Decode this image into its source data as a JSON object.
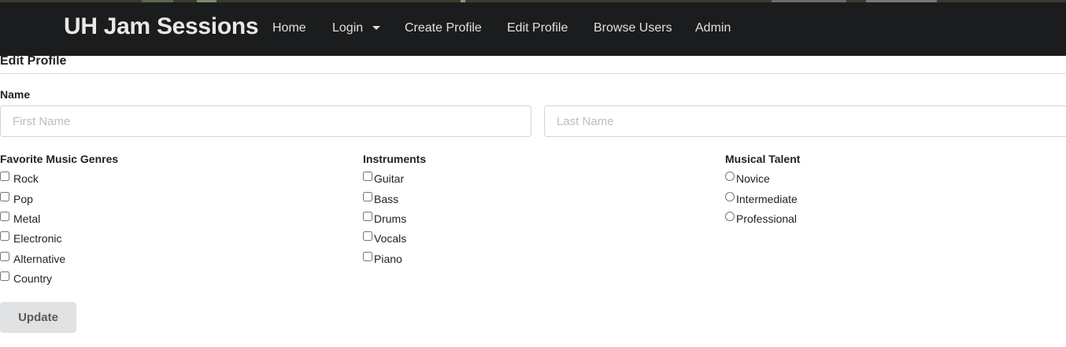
{
  "navbar": {
    "brand": "UH Jam Sessions",
    "links": [
      "Home",
      "Login",
      "Create Profile",
      "Edit Profile",
      "Browse Users",
      "Admin"
    ]
  },
  "page": {
    "title": "Edit Profile"
  },
  "form": {
    "name_label": "Name",
    "first_name_placeholder": "First Name",
    "last_name_placeholder": "Last Name",
    "first_name_value": "",
    "last_name_value": "",
    "genres": {
      "label": "Favorite Music Genres",
      "options": [
        {
          "label": "Rock",
          "checked": false
        },
        {
          "label": "Pop",
          "checked": false
        },
        {
          "label": "Metal",
          "checked": false
        },
        {
          "label": "Electronic",
          "checked": false
        },
        {
          "label": "Alternative",
          "checked": false
        },
        {
          "label": "Country",
          "checked": false
        }
      ]
    },
    "instruments": {
      "label": "Instruments",
      "options": [
        {
          "label": "Guitar",
          "checked": false
        },
        {
          "label": "Bass",
          "checked": false
        },
        {
          "label": "Drums",
          "checked": false
        },
        {
          "label": "Vocals",
          "checked": false
        },
        {
          "label": "Piano",
          "checked": false
        }
      ]
    },
    "talent": {
      "label": "Musical Talent",
      "options": [
        {
          "label": "Novice",
          "checked": false
        },
        {
          "label": "Intermediate",
          "checked": false
        },
        {
          "label": "Professional",
          "checked": false
        }
      ]
    },
    "submit_label": "Update"
  },
  "colors": {
    "navbar_bg": "#1b1c1d",
    "button_bg": "#e0e1e2",
    "input_border": "#d4d4d5"
  }
}
